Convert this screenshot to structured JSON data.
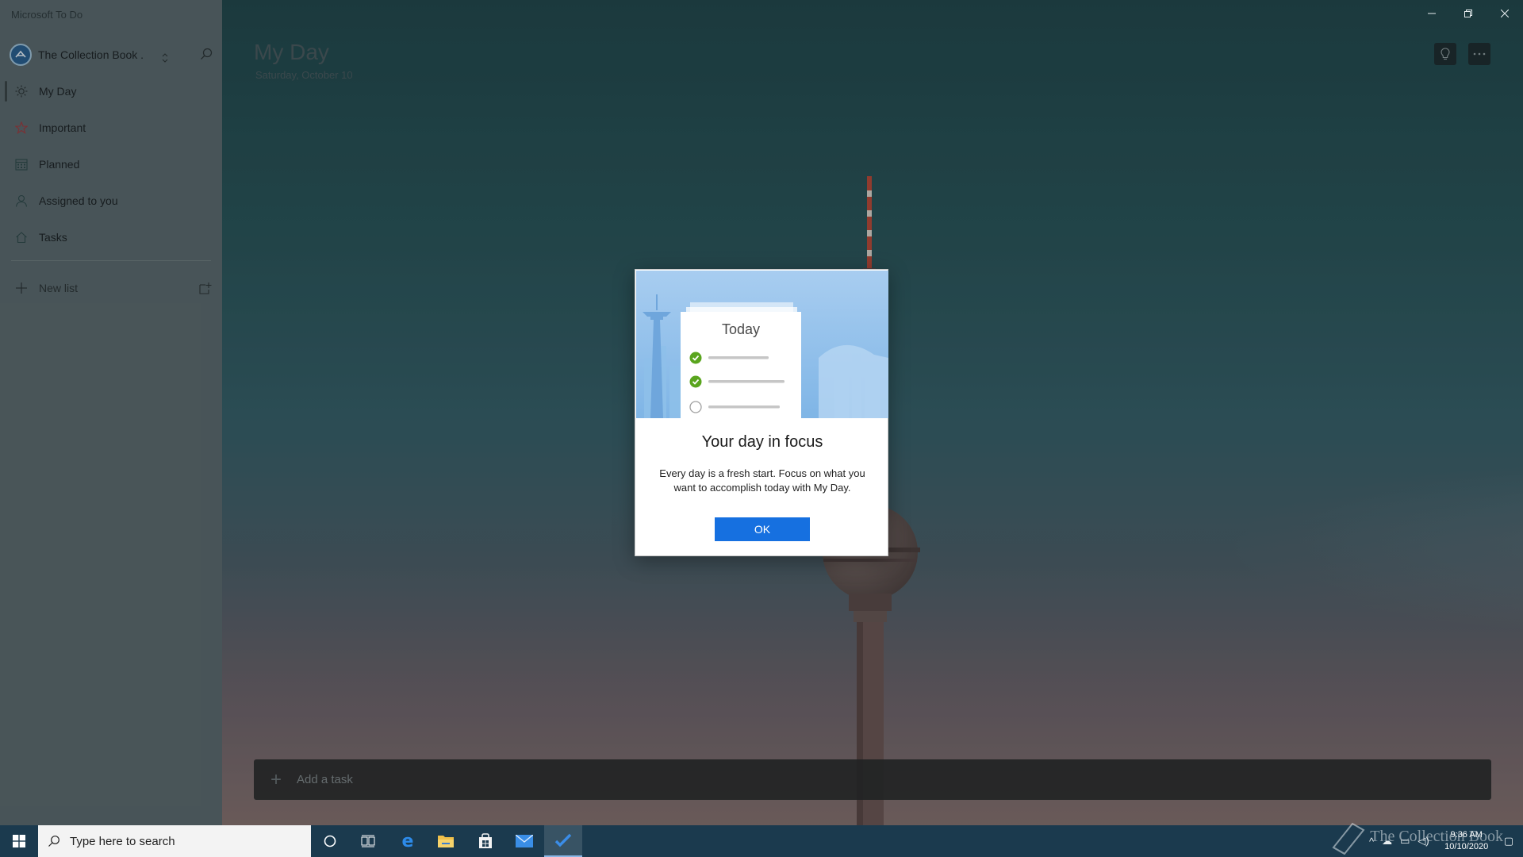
{
  "window": {
    "title": "Microsoft To Do"
  },
  "account": {
    "name": "The Collection Book ."
  },
  "sidebar": {
    "items": [
      {
        "label": "My Day",
        "icon": "sun-icon"
      },
      {
        "label": "Important",
        "icon": "star-icon"
      },
      {
        "label": "Planned",
        "icon": "calendar-icon"
      },
      {
        "label": "Assigned to you",
        "icon": "person-icon"
      },
      {
        "label": "Tasks",
        "icon": "home-icon"
      }
    ],
    "new_list_label": "New list"
  },
  "header": {
    "title": "My Day",
    "date": "Saturday, October 10"
  },
  "add_task": {
    "placeholder": "Add a task"
  },
  "dialog": {
    "card_title": "Today",
    "title": "Your day in focus",
    "body": "Every day is a fresh start. Focus on what you want to accomplish today with My Day.",
    "ok_label": "OK"
  },
  "taskbar": {
    "search_placeholder": "Type here to search",
    "time": "9:36 AM",
    "date": "10/10/2020"
  },
  "watermark": {
    "text": "The Collection Book"
  },
  "colors": {
    "accent": "#1670e0",
    "check_green": "#5aa51e",
    "sidebar_bg": "#5b6a6e",
    "taskbar_bg": "#1b3a4e"
  }
}
